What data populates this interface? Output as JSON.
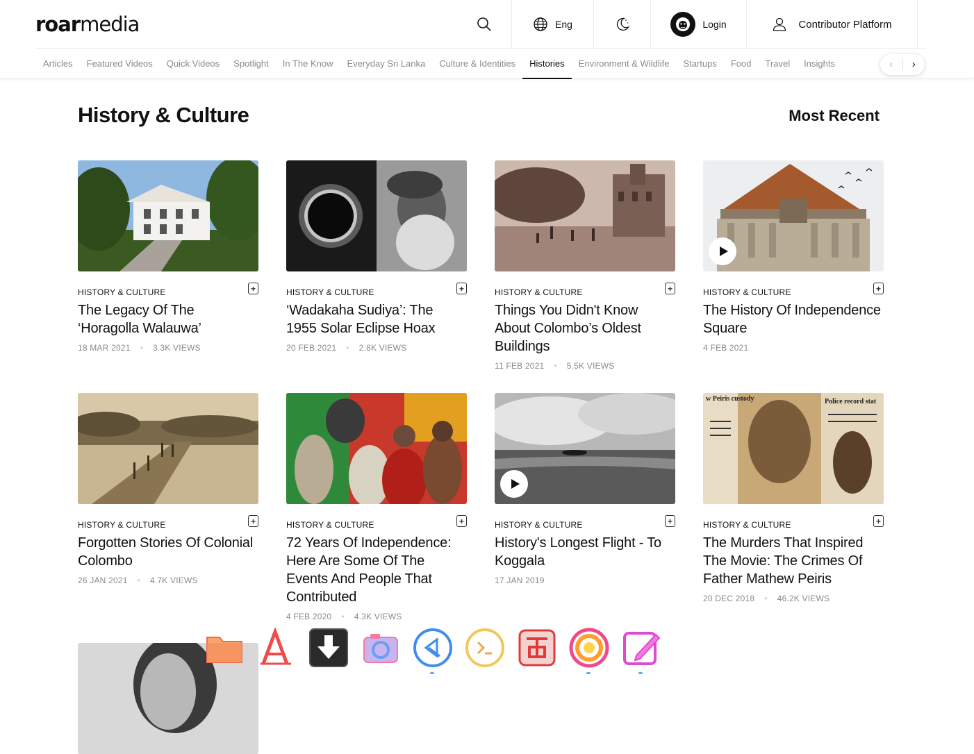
{
  "header": {
    "logo_bold": "roar",
    "logo_light": "media",
    "lang_label": "Eng",
    "login_label": "Login",
    "contributor_label": "Contributor Platform"
  },
  "nav": {
    "items": [
      {
        "label": "Articles"
      },
      {
        "label": "Featured Videos"
      },
      {
        "label": "Quick Videos"
      },
      {
        "label": "Spotlight"
      },
      {
        "label": "In The Know"
      },
      {
        "label": "Everyday Sri Lanka"
      },
      {
        "label": "Culture & Identities"
      },
      {
        "label": "Histories",
        "active": true
      },
      {
        "label": "Environment & Wildlife"
      },
      {
        "label": "Startups"
      },
      {
        "label": "Food"
      },
      {
        "label": "Travel"
      },
      {
        "label": "Insights"
      }
    ],
    "prev_glyph": "‹",
    "next_glyph": "›"
  },
  "page": {
    "title": "History & Culture",
    "sort_label": "Most Recent"
  },
  "articles": [
    {
      "category": "HISTORY & CULTURE",
      "title": "The Legacy Of The ‘Horagolla Walauwa’",
      "date": "18 MAR 2021",
      "views": "3.3K VIEWS",
      "video": false
    },
    {
      "category": "HISTORY & CULTURE",
      "title": "‘Wadakaha Sudiya’: The 1955 Solar Eclipse Hoax",
      "date": "20 FEB 2021",
      "views": "2.8K VIEWS",
      "video": false
    },
    {
      "category": "HISTORY & CULTURE",
      "title": "Things You Didn't Know About Colombo’s Oldest Buildings",
      "date": "11 FEB 2021",
      "views": "5.5K VIEWS",
      "video": false
    },
    {
      "category": "HISTORY & CULTURE",
      "title": "The History Of Independence Square",
      "date": "4 FEB 2021",
      "views": "",
      "video": true
    },
    {
      "category": "HISTORY & CULTURE",
      "title": "Forgotten Stories Of Colonial Colombo",
      "date": "26 JAN 2021",
      "views": "4.7K VIEWS",
      "video": false
    },
    {
      "category": "HISTORY & CULTURE",
      "title": "72 Years Of Independence: Here Are Some Of The Events And People That Contributed",
      "date": "4 FEB 2020",
      "views": "4.3K VIEWS",
      "video": false
    },
    {
      "category": "HISTORY & CULTURE",
      "title": "History's Longest Flight - To Koggala",
      "date": "17 JAN 2019",
      "views": "",
      "video": true
    },
    {
      "category": "HISTORY & CULTURE",
      "title": "The Murders That Inspired The Movie: The Crimes Of Father Mathew Peiris",
      "date": "20 DEC 2018",
      "views": "46.2K VIEWS",
      "video": false
    }
  ],
  "image_text": {
    "card8_left": "w Peiris custody",
    "card8_right": "Police record stat"
  },
  "dock": {
    "apps": [
      "files-icon",
      "font-viewer-icon",
      "downloader-icon",
      "screenshot-icon",
      "code-editor-icon",
      "terminal-icon",
      "office-icon",
      "firefox-icon",
      "text-editor-icon"
    ]
  },
  "colors": {
    "text": "#111111",
    "muted": "#8a8a8a",
    "border": "#ececec"
  }
}
